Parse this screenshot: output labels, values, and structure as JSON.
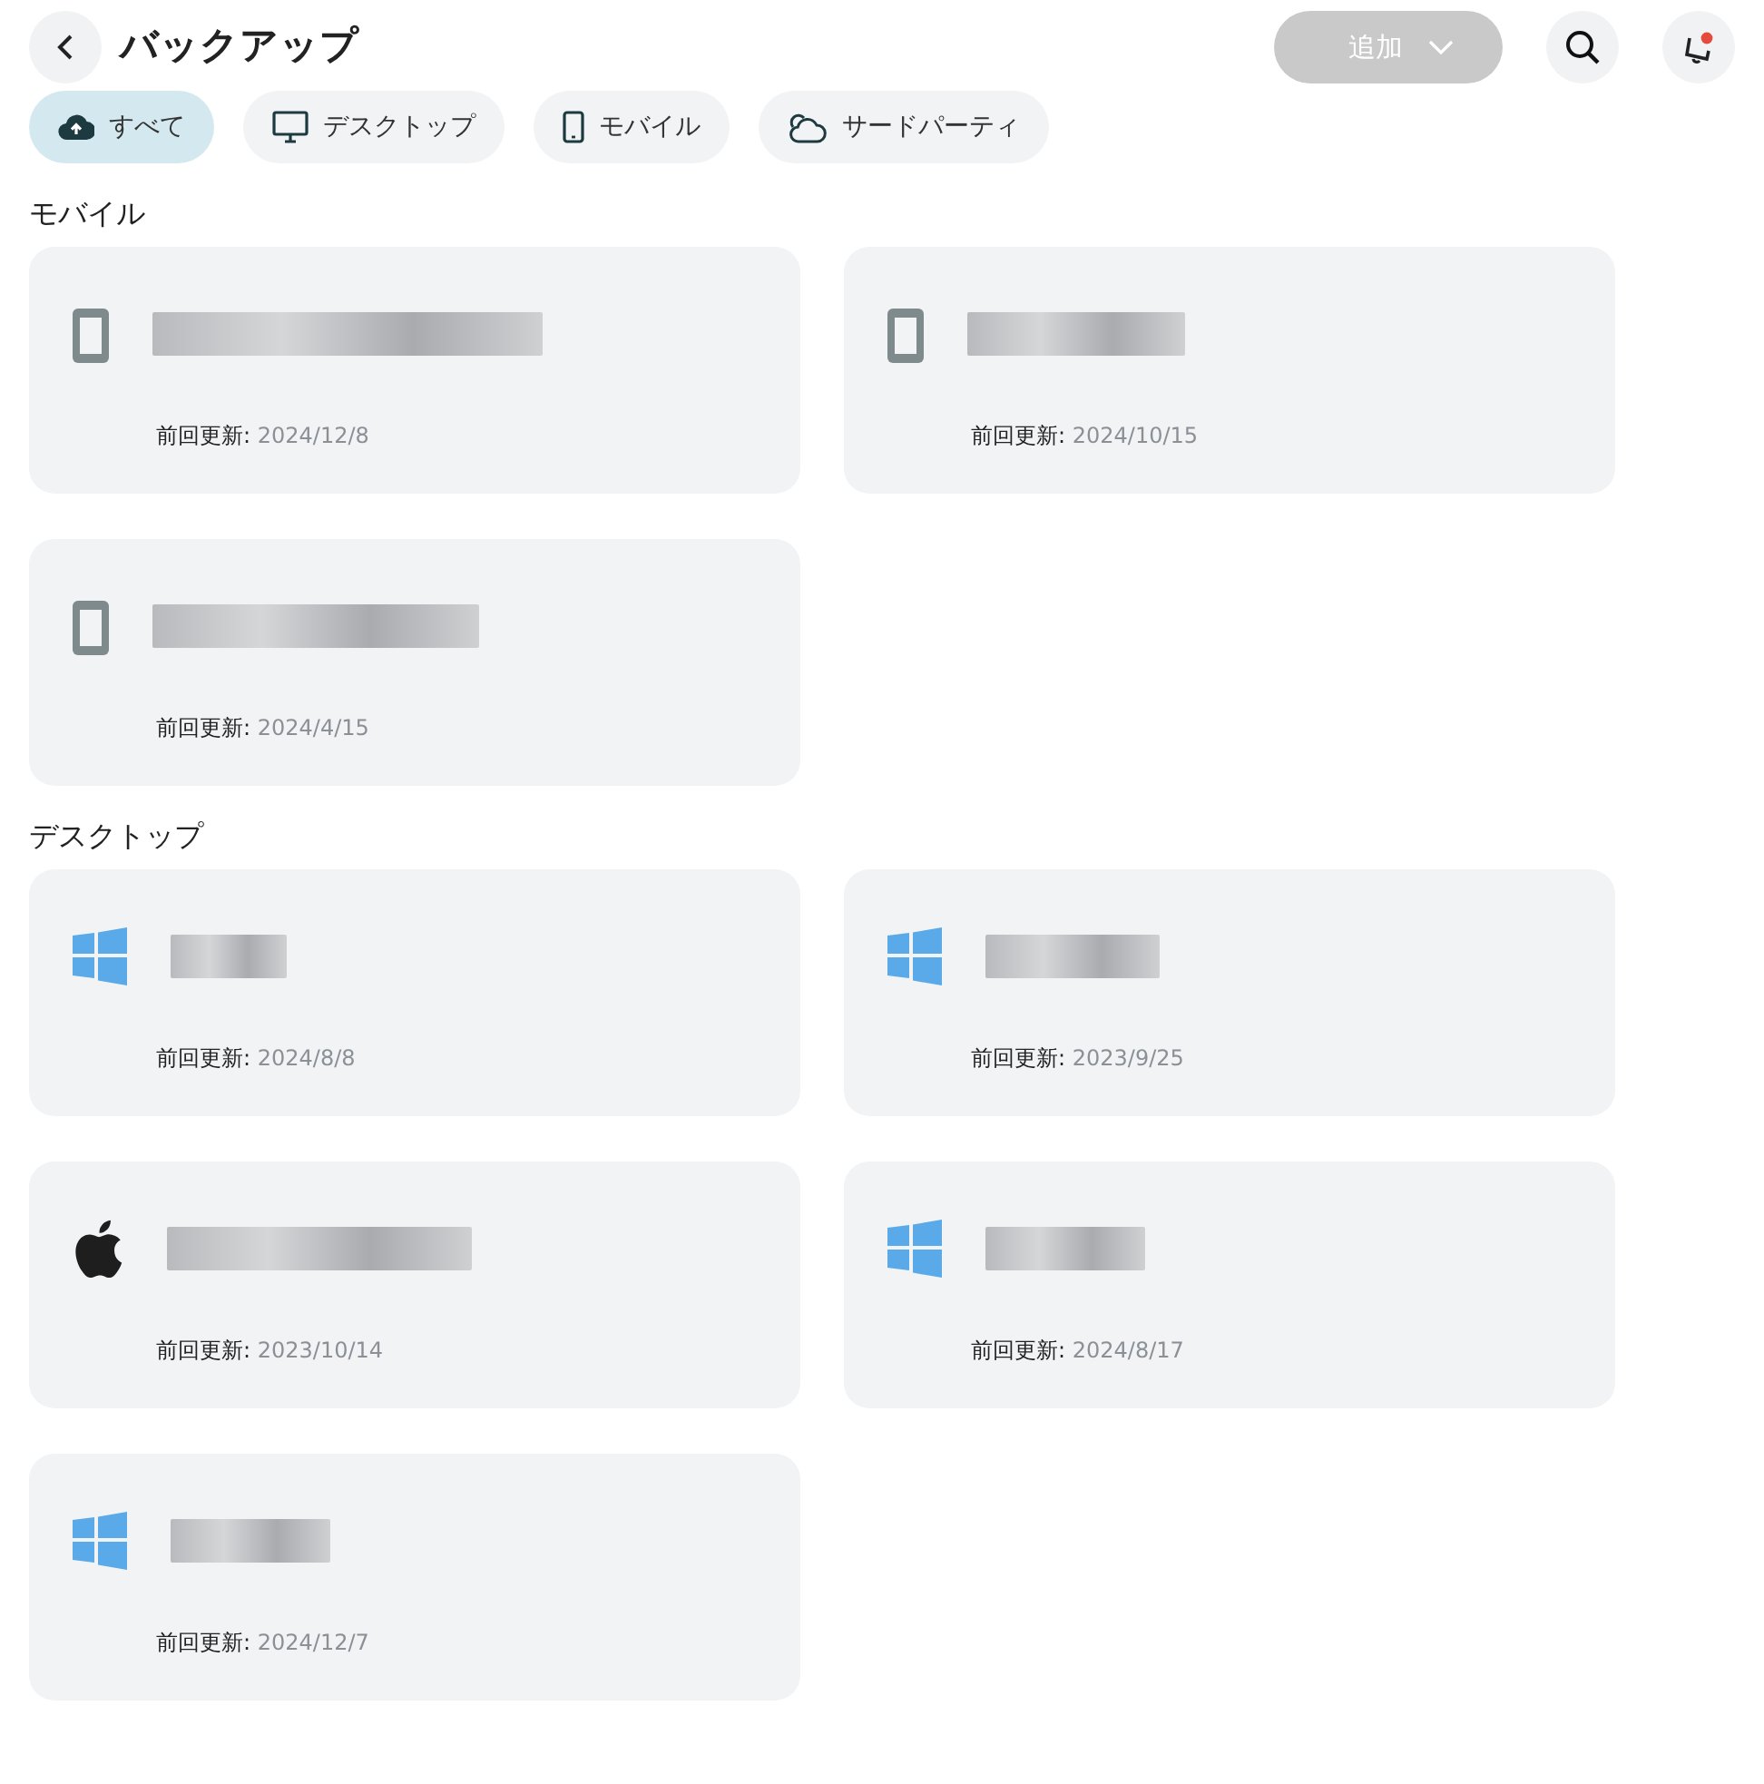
{
  "header": {
    "title": "バックアップ",
    "add_button": {
      "label": "追加",
      "disabled": true
    }
  },
  "filters": [
    {
      "kind": "all",
      "label": "すべて",
      "selected": true
    },
    {
      "kind": "desktop",
      "label": "デスクトップ",
      "selected": false
    },
    {
      "kind": "mobile",
      "label": "モバイル",
      "selected": false
    },
    {
      "kind": "cloud",
      "label": "サードパーティ",
      "selected": false
    }
  ],
  "sections": [
    {
      "title": "モバイル",
      "devices": [
        {
          "kind": "mobile",
          "update_label": "前回更新:",
          "date": "2024/12/8"
        },
        {
          "kind": "mobile",
          "update_label": "前回更新:",
          "date": "2024/10/15"
        },
        {
          "kind": "mobile",
          "update_label": "前回更新:",
          "date": "2024/4/15"
        }
      ]
    },
    {
      "title": "デスクトップ",
      "devices": [
        {
          "kind": "windows",
          "update_label": "前回更新:",
          "date": "2024/8/8"
        },
        {
          "kind": "windows",
          "update_label": "前回更新:",
          "date": "2023/9/25"
        },
        {
          "kind": "apple",
          "update_label": "前回更新:",
          "date": "2023/10/14"
        },
        {
          "kind": "windows",
          "update_label": "前回更新:",
          "date": "2024/8/17"
        },
        {
          "kind": "windows",
          "update_label": "前回更新:",
          "date": "2024/12/7"
        }
      ]
    }
  ]
}
